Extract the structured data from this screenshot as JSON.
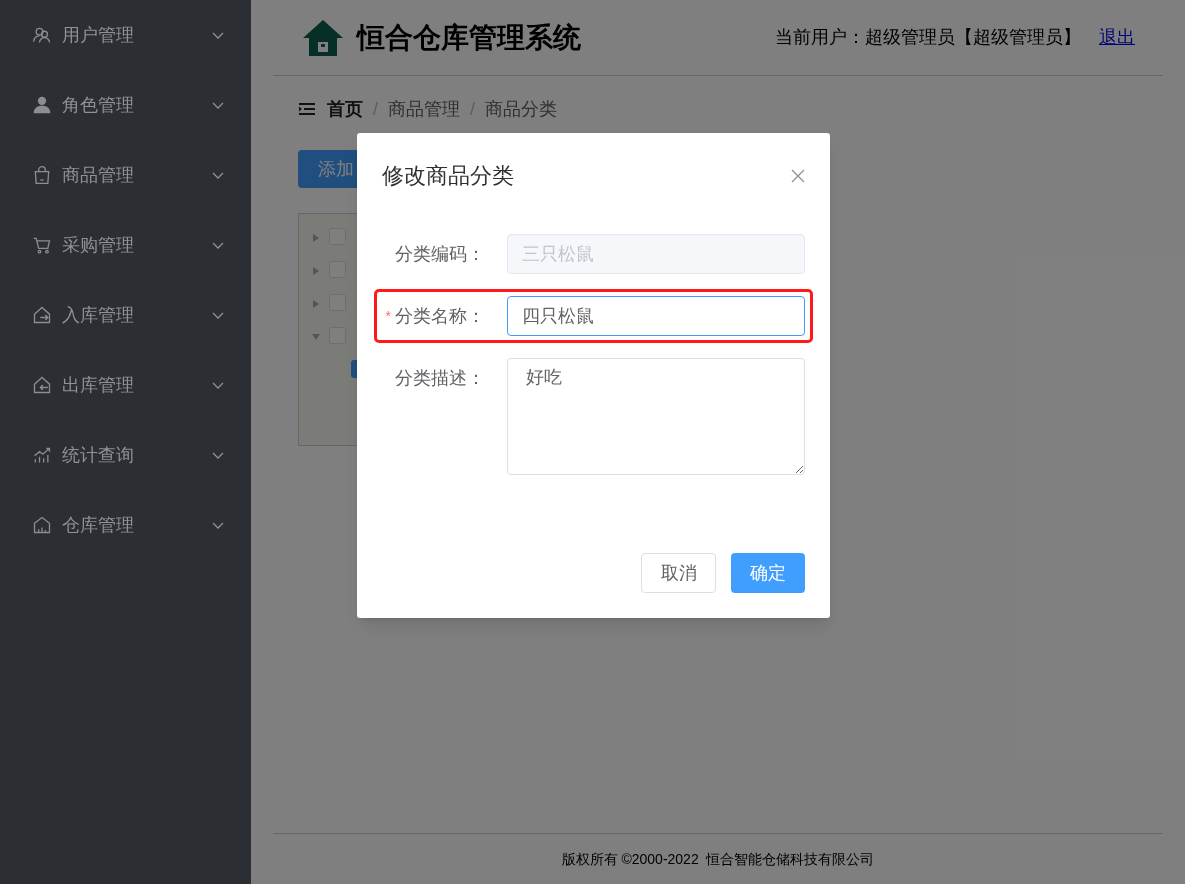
{
  "sidebar": {
    "items": [
      {
        "label": "用户管理",
        "kind": "users",
        "expanded": false
      },
      {
        "label": "角色管理",
        "kind": "person",
        "expanded": false
      },
      {
        "label": "商品管理",
        "kind": "bag",
        "expanded": false
      },
      {
        "label": "采购管理",
        "kind": "cart",
        "expanded": false
      },
      {
        "label": "入库管理",
        "kind": "inbound",
        "expanded": false
      },
      {
        "label": "出库管理",
        "kind": "outbound",
        "expanded": false
      },
      {
        "label": "统计查询",
        "kind": "chart",
        "expanded": false
      },
      {
        "label": "仓库管理",
        "kind": "warehouse",
        "expanded": false
      }
    ]
  },
  "header": {
    "title": "恒合仓库管理系统",
    "current_user": "当前用户：超级管理员【超级管理员】",
    "logout": "退出"
  },
  "breadcrumb": {
    "separator": "/",
    "items": [
      "首页",
      "商品管理",
      "商品分类"
    ]
  },
  "add_button": "添加",
  "tree": [
    {
      "expanded": false,
      "checked": false
    },
    {
      "expanded": false,
      "checked": false
    },
    {
      "expanded": false,
      "checked": false
    },
    {
      "expanded": true,
      "checked": false
    }
  ],
  "dialog": {
    "title": "修改商品分类",
    "fields": [
      {
        "kind": "input",
        "label": "分类编码：",
        "value": "三只松鼠",
        "disabled": true,
        "focused": false,
        "highlighted": false
      },
      {
        "kind": "input",
        "label": "分类名称：",
        "required_mark": "*",
        "value": "四只松鼠",
        "disabled": false,
        "focused": true,
        "highlighted": true
      },
      {
        "kind": "textarea",
        "label": "分类描述：",
        "value": "好吃",
        "highlighted": false
      }
    ],
    "cancel": "取消",
    "confirm": "确定"
  },
  "footer": "版权所有 ©2000-2022  恒合智能仓储科技有限公司"
}
